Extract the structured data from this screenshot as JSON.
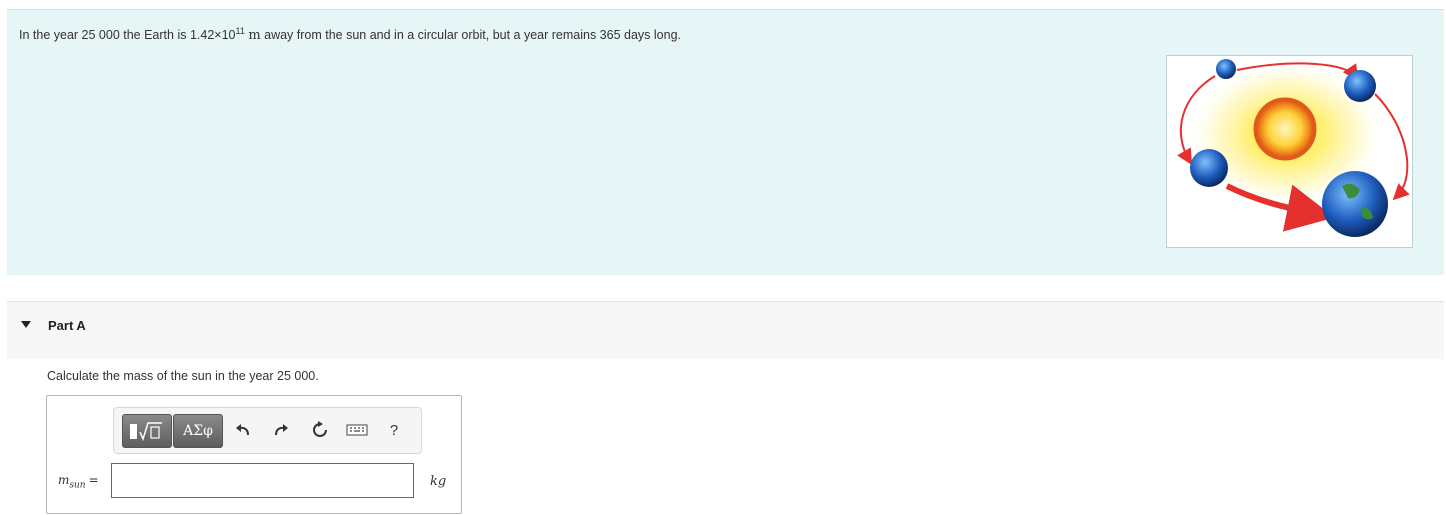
{
  "problem": {
    "text_before": "In the year 25 000 the Earth is 1.42×10",
    "exponent": "11",
    "unit": "m",
    "text_after": " away from the sun and in a circular orbit, but a year remains 365 days long."
  },
  "figure": {
    "icon": "sun-earth-orbit-illustration"
  },
  "part": {
    "title": "Part A",
    "toggle_icon": "caret-down-icon"
  },
  "question": "Calculate the mass of the sun in the year 25 000.",
  "toolbar": {
    "greek_label": "ΑΣφ",
    "help_label": "?",
    "icons": [
      "templates-icon",
      "greek-letters-icon",
      "undo-icon",
      "redo-icon",
      "reset-icon",
      "keyboard-icon",
      "help-icon"
    ]
  },
  "answer": {
    "variable": "m",
    "subscript": "sun",
    "equals": "=",
    "value": "",
    "unit": "kg"
  },
  "colors": {
    "problem_bg": "#e6f6f6",
    "part_bg": "#f7f7f7",
    "input_border": "#2a7f8a",
    "orbit_arrow": "#e53030"
  }
}
